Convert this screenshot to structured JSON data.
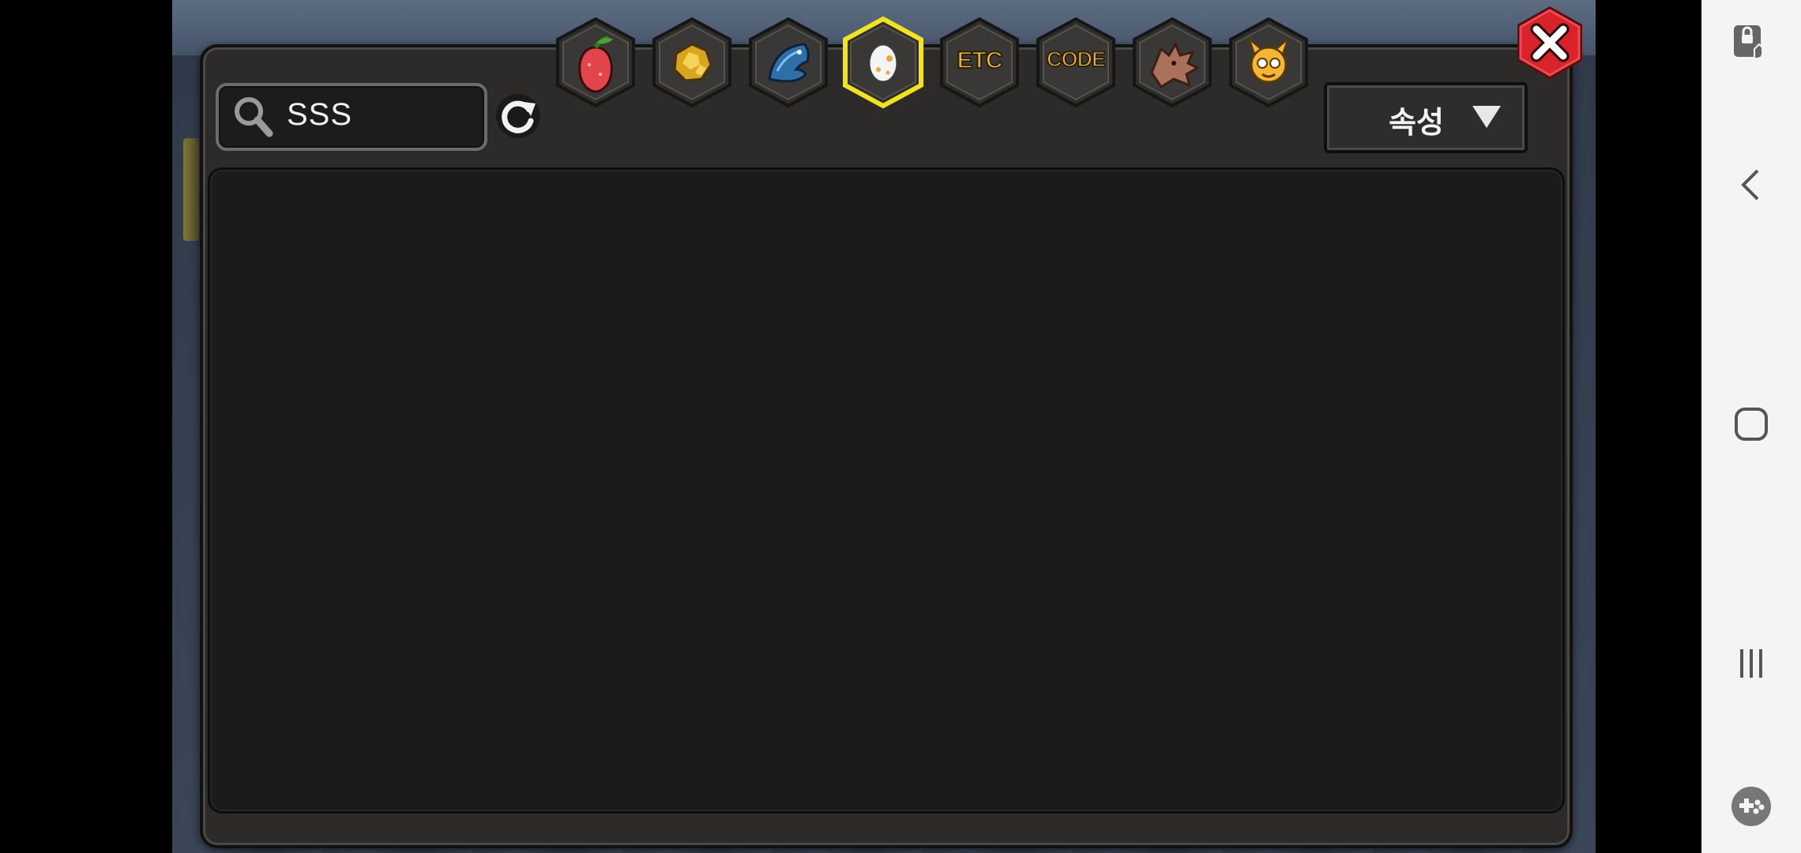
{
  "search": {
    "value": "SSS"
  },
  "tabs": [
    {
      "name": "fruit",
      "icon": "pear-fruit-icon",
      "selected": false
    },
    {
      "name": "gold",
      "icon": "gold-nugget-icon",
      "selected": false
    },
    {
      "name": "wing",
      "icon": "blue-wing-icon",
      "selected": false
    },
    {
      "name": "egg",
      "icon": "egg-icon",
      "selected": true
    },
    {
      "name": "etc",
      "label": "ETC",
      "selected": false
    },
    {
      "name": "code",
      "label": "CODE",
      "selected": false
    },
    {
      "name": "dragon",
      "icon": "dragon-head-icon",
      "selected": false
    },
    {
      "name": "monster",
      "icon": "yellow-monster-icon",
      "selected": false
    }
  ],
  "dropdown": {
    "selected": "속성"
  },
  "colors": {
    "tab_highlight": "#f2e41c",
    "close_red": "#d8232b",
    "code_yellow": "#f7c62a"
  },
  "navbar": {
    "items": [
      "screen-lock-icon",
      "back-icon",
      "home-icon",
      "recents-icon",
      "game-tools-icon"
    ]
  }
}
